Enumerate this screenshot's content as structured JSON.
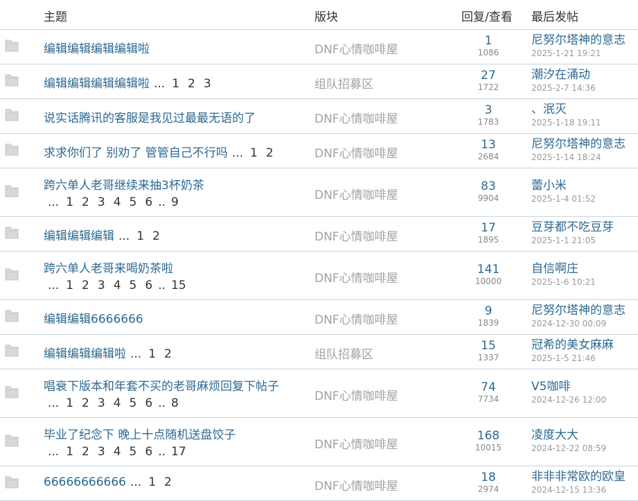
{
  "header": {
    "topic": "主题",
    "board": "版块",
    "stats": "回复/查看",
    "last_post": "最后发帖"
  },
  "rows": [
    {
      "title": "编辑编辑编辑编辑啦",
      "pages": [],
      "board": "DNF心情咖啡屋",
      "board_style": "normal",
      "replies": "1",
      "views": "1086",
      "last_author": "尼努尔塔神的意志",
      "last_time": "2025-1-21 19:21"
    },
    {
      "title": "编辑编辑编辑编辑啦",
      "pages": [
        "1",
        "2",
        "3"
      ],
      "board": "组队招募区",
      "board_style": "normal",
      "replies": "27",
      "views": "1722",
      "last_author": "潮汐在涌动",
      "last_time": "2025-2-7 14:36"
    },
    {
      "title": "说实话腾讯的客服是我见过最最无语的了",
      "pages": [],
      "board": "DNF心情咖啡屋",
      "replies": "3",
      "views": "1783",
      "last_author": "、泯灭",
      "last_time": "2025-1-18 19:11"
    },
    {
      "title": "求求你们了 别劝了 管管自己不行吗",
      "pages": [
        "1",
        "2"
      ],
      "board": "DNF心情咖啡屋",
      "replies": "13",
      "views": "2684",
      "last_author": "尼努尔塔神的意志",
      "last_time": "2025-1-14 18:24"
    },
    {
      "title": "跨六单人老哥继续来抽3杯奶茶",
      "pages": [
        "1",
        "2",
        "3",
        "4",
        "5",
        "6",
        "..",
        "9"
      ],
      "wrap": true,
      "board": "DNF心情咖啡屋",
      "replies": "83",
      "views": "9904",
      "last_author": "蕾小米",
      "last_time": "2025-1-4 01:52"
    },
    {
      "title": "编辑编辑编辑",
      "pages": [
        "1",
        "2"
      ],
      "board": "DNF心情咖啡屋",
      "replies": "17",
      "views": "1895",
      "last_author": "豆芽都不吃豆芽",
      "last_time": "2025-1-1 21:05"
    },
    {
      "title": "跨六单人老哥来喝奶茶啦",
      "pages": [
        "1",
        "2",
        "3",
        "4",
        "5",
        "6",
        "..",
        "15"
      ],
      "wrap": true,
      "board": "DNF心情咖啡屋",
      "replies": "141",
      "views": "10000",
      "last_author": "自信啊庄",
      "last_time": "2025-1-6 10:21"
    },
    {
      "title": "编辑编辑6666666",
      "pages": [],
      "board": "DNF心情咖啡屋",
      "replies": "9",
      "views": "1839",
      "last_author": "尼努尔塔神的意志",
      "last_time": "2024-12-30 00:09"
    },
    {
      "title": "编辑编辑编辑啦",
      "pages": [
        "1",
        "2"
      ],
      "board": "组队招募区",
      "replies": "15",
      "views": "1337",
      "last_author": "冠希的美女麻麻",
      "last_time": "2025-1-5 21:46"
    },
    {
      "title": "唱衰下版本和年套不买的老哥麻烦回复下帖子",
      "pages": [
        "1",
        "2",
        "3",
        "4",
        "5",
        "6",
        "..",
        "8"
      ],
      "wrap": true,
      "board": "DNF心情咖啡屋",
      "replies": "74",
      "views": "7734",
      "last_author": "V5咖啡",
      "last_time": "2024-12-26 12:00"
    },
    {
      "title": "毕业了纪念下 晚上十点随机送盘饺子",
      "pages": [
        "1",
        "2",
        "3",
        "4",
        "5",
        "6",
        "..",
        "17"
      ],
      "wrap": true,
      "board": "DNF心情咖啡屋",
      "replies": "168",
      "views": "10015",
      "last_author": "凌度大大",
      "last_time": "2024-12-22 08:59"
    },
    {
      "title": "66666666666",
      "pages": [
        "1",
        "2"
      ],
      "board": "DNF心情咖啡屋",
      "replies": "18",
      "views": "2974",
      "last_author": "非非非常欧的欧皇",
      "last_time": "2024-12-15 13:36"
    }
  ],
  "colors": {
    "link": "#2d6993",
    "muted": "#a2a2a2",
    "divider": "#c5d4e0"
  },
  "icons": {
    "row_icon": "folder-icon"
  }
}
